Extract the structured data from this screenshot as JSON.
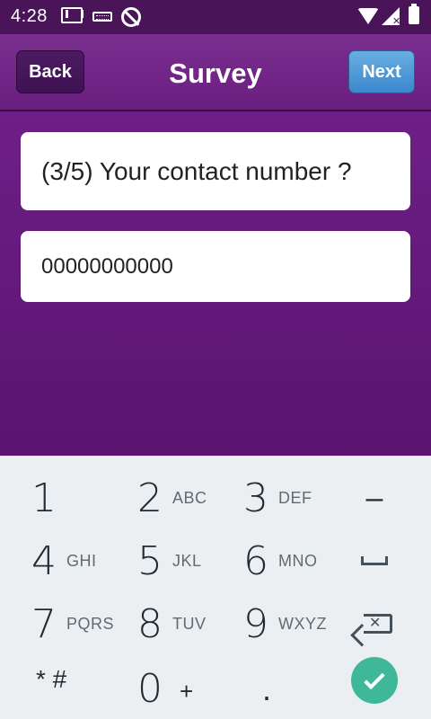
{
  "status_bar": {
    "time": "4:28",
    "icons": [
      "gmail-icon",
      "keyboard-icon",
      "no-sync-icon",
      "wifi-icon",
      "signal-icon",
      "battery-icon"
    ]
  },
  "header": {
    "back_label": "Back",
    "title": "Survey",
    "next_label": "Next",
    "colors": {
      "header": "#6a1f80",
      "back": "#3e1252",
      "next": "#3b87cc"
    }
  },
  "survey": {
    "question": "(3/5) Your contact number ?",
    "answer": "00000000000"
  },
  "keypad": {
    "keys": [
      {
        "num": "1",
        "letters": ""
      },
      {
        "num": "2",
        "letters": "ABC"
      },
      {
        "num": "3",
        "letters": "DEF"
      },
      {
        "num": "4",
        "letters": "GHI"
      },
      {
        "num": "5",
        "letters": "JKL"
      },
      {
        "num": "6",
        "letters": "MNO"
      },
      {
        "num": "7",
        "letters": "PQRS"
      },
      {
        "num": "8",
        "letters": "TUV"
      },
      {
        "num": "9",
        "letters": "WXYZ"
      },
      {
        "num": "0",
        "letters": "+"
      }
    ],
    "star_label": "* #",
    "dash_label": "–",
    "dot_label": ".",
    "done_color": "#3fb89a"
  }
}
